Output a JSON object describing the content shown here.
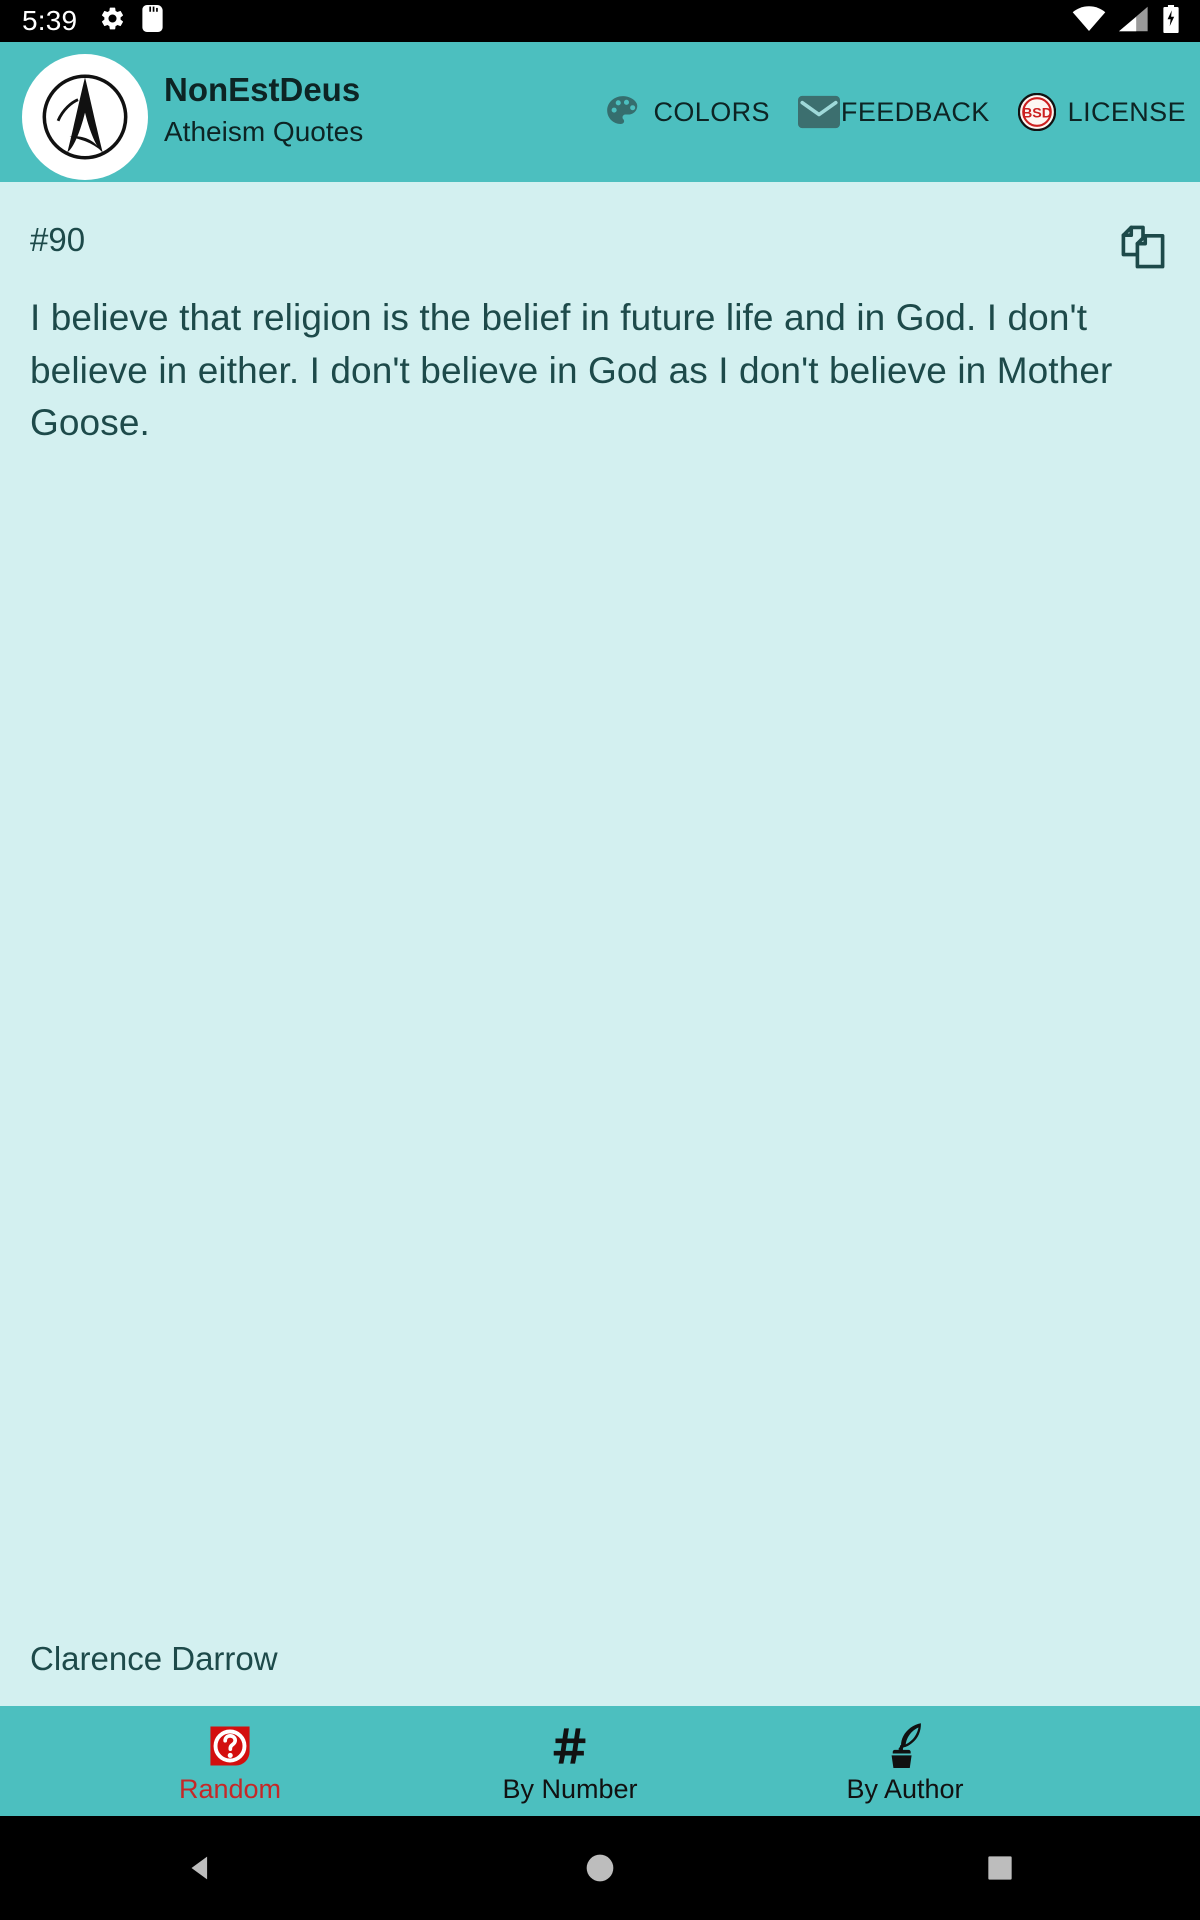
{
  "statusbar": {
    "time": "5:39",
    "left_icons": [
      "gear-icon",
      "sd-card-icon"
    ],
    "right_icons": [
      "wifi-icon",
      "cellular-signal-icon",
      "battery-charging-icon"
    ]
  },
  "appbar": {
    "logo": "atheist-symbol-logo",
    "title": "NonEstDeus",
    "subtitle": "Atheism Quotes",
    "background_color": "#4cbfbf",
    "actions": [
      {
        "label": "COLORS",
        "icon": "palette-icon"
      },
      {
        "label": "FEEDBACK",
        "icon": "mail-icon"
      },
      {
        "label": "LICENSE",
        "icon": "bsd-badge-icon",
        "badge_text": "BSD"
      }
    ]
  },
  "content": {
    "quote_number": "#90",
    "copy_icon": "copy-pages-icon",
    "quote_text": "I believe that religion is the belief in future life and in God. I don't believe in either. I don't believe in God as I don't believe in Mother Goose.",
    "author": "Clarence Darrow",
    "background_color": "#d3f0f0",
    "text_color": "#1d4a4a"
  },
  "bottom_nav": {
    "background_color": "#4cbfbf",
    "active_color": "#c62828",
    "items": [
      {
        "label": "Random",
        "icon": "question-mark-icon",
        "active": true
      },
      {
        "label": "By Number",
        "icon": "hash-icon",
        "active": false
      },
      {
        "label": "By Author",
        "icon": "quill-inkwell-icon",
        "active": false
      }
    ]
  },
  "system_nav": {
    "buttons": [
      "back-triangle-icon",
      "home-circle-icon",
      "recents-square-icon"
    ]
  }
}
